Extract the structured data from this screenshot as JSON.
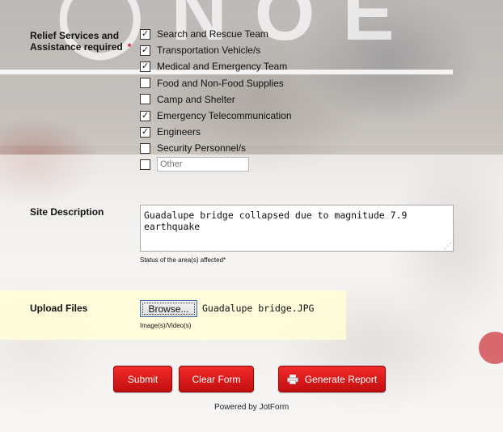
{
  "relief": {
    "label_line1": "Relief Services and",
    "label_line2": "Assistance required",
    "required_mark": "*",
    "options": [
      {
        "label": "Search and Rescue Team",
        "checked": true
      },
      {
        "label": "Transportation Vehicle/s",
        "checked": true
      },
      {
        "label": "Medical and Emergency Team",
        "checked": true
      },
      {
        "label": "Food and Non-Food Supplies",
        "checked": false
      },
      {
        "label": "Camp and Shelter",
        "checked": false
      },
      {
        "label": "Emergency Telecommunication",
        "checked": true
      },
      {
        "label": "Engineers",
        "checked": true
      },
      {
        "label": "Security Personnel/s",
        "checked": false
      }
    ],
    "other_checked": false,
    "other_placeholder": "Other"
  },
  "site": {
    "label": "Site Description",
    "value": "Guadalupe bridge collapsed due to magnitude 7.9 earthquake",
    "sublabel": "Status of the area(s) affected*"
  },
  "upload": {
    "label": "Upload Files",
    "browse_label": "Browse...",
    "file_name": "Guadalupe bridge.JPG",
    "sublabel": "Image(s)/Video(s)"
  },
  "buttons": {
    "submit": "Submit",
    "clear": "Clear Form",
    "report": "Generate Report"
  },
  "footer": {
    "powered": "Powered by JotForm"
  },
  "colors": {
    "accent_red": "#d0131b",
    "upload_bg": "#fffdd7"
  }
}
